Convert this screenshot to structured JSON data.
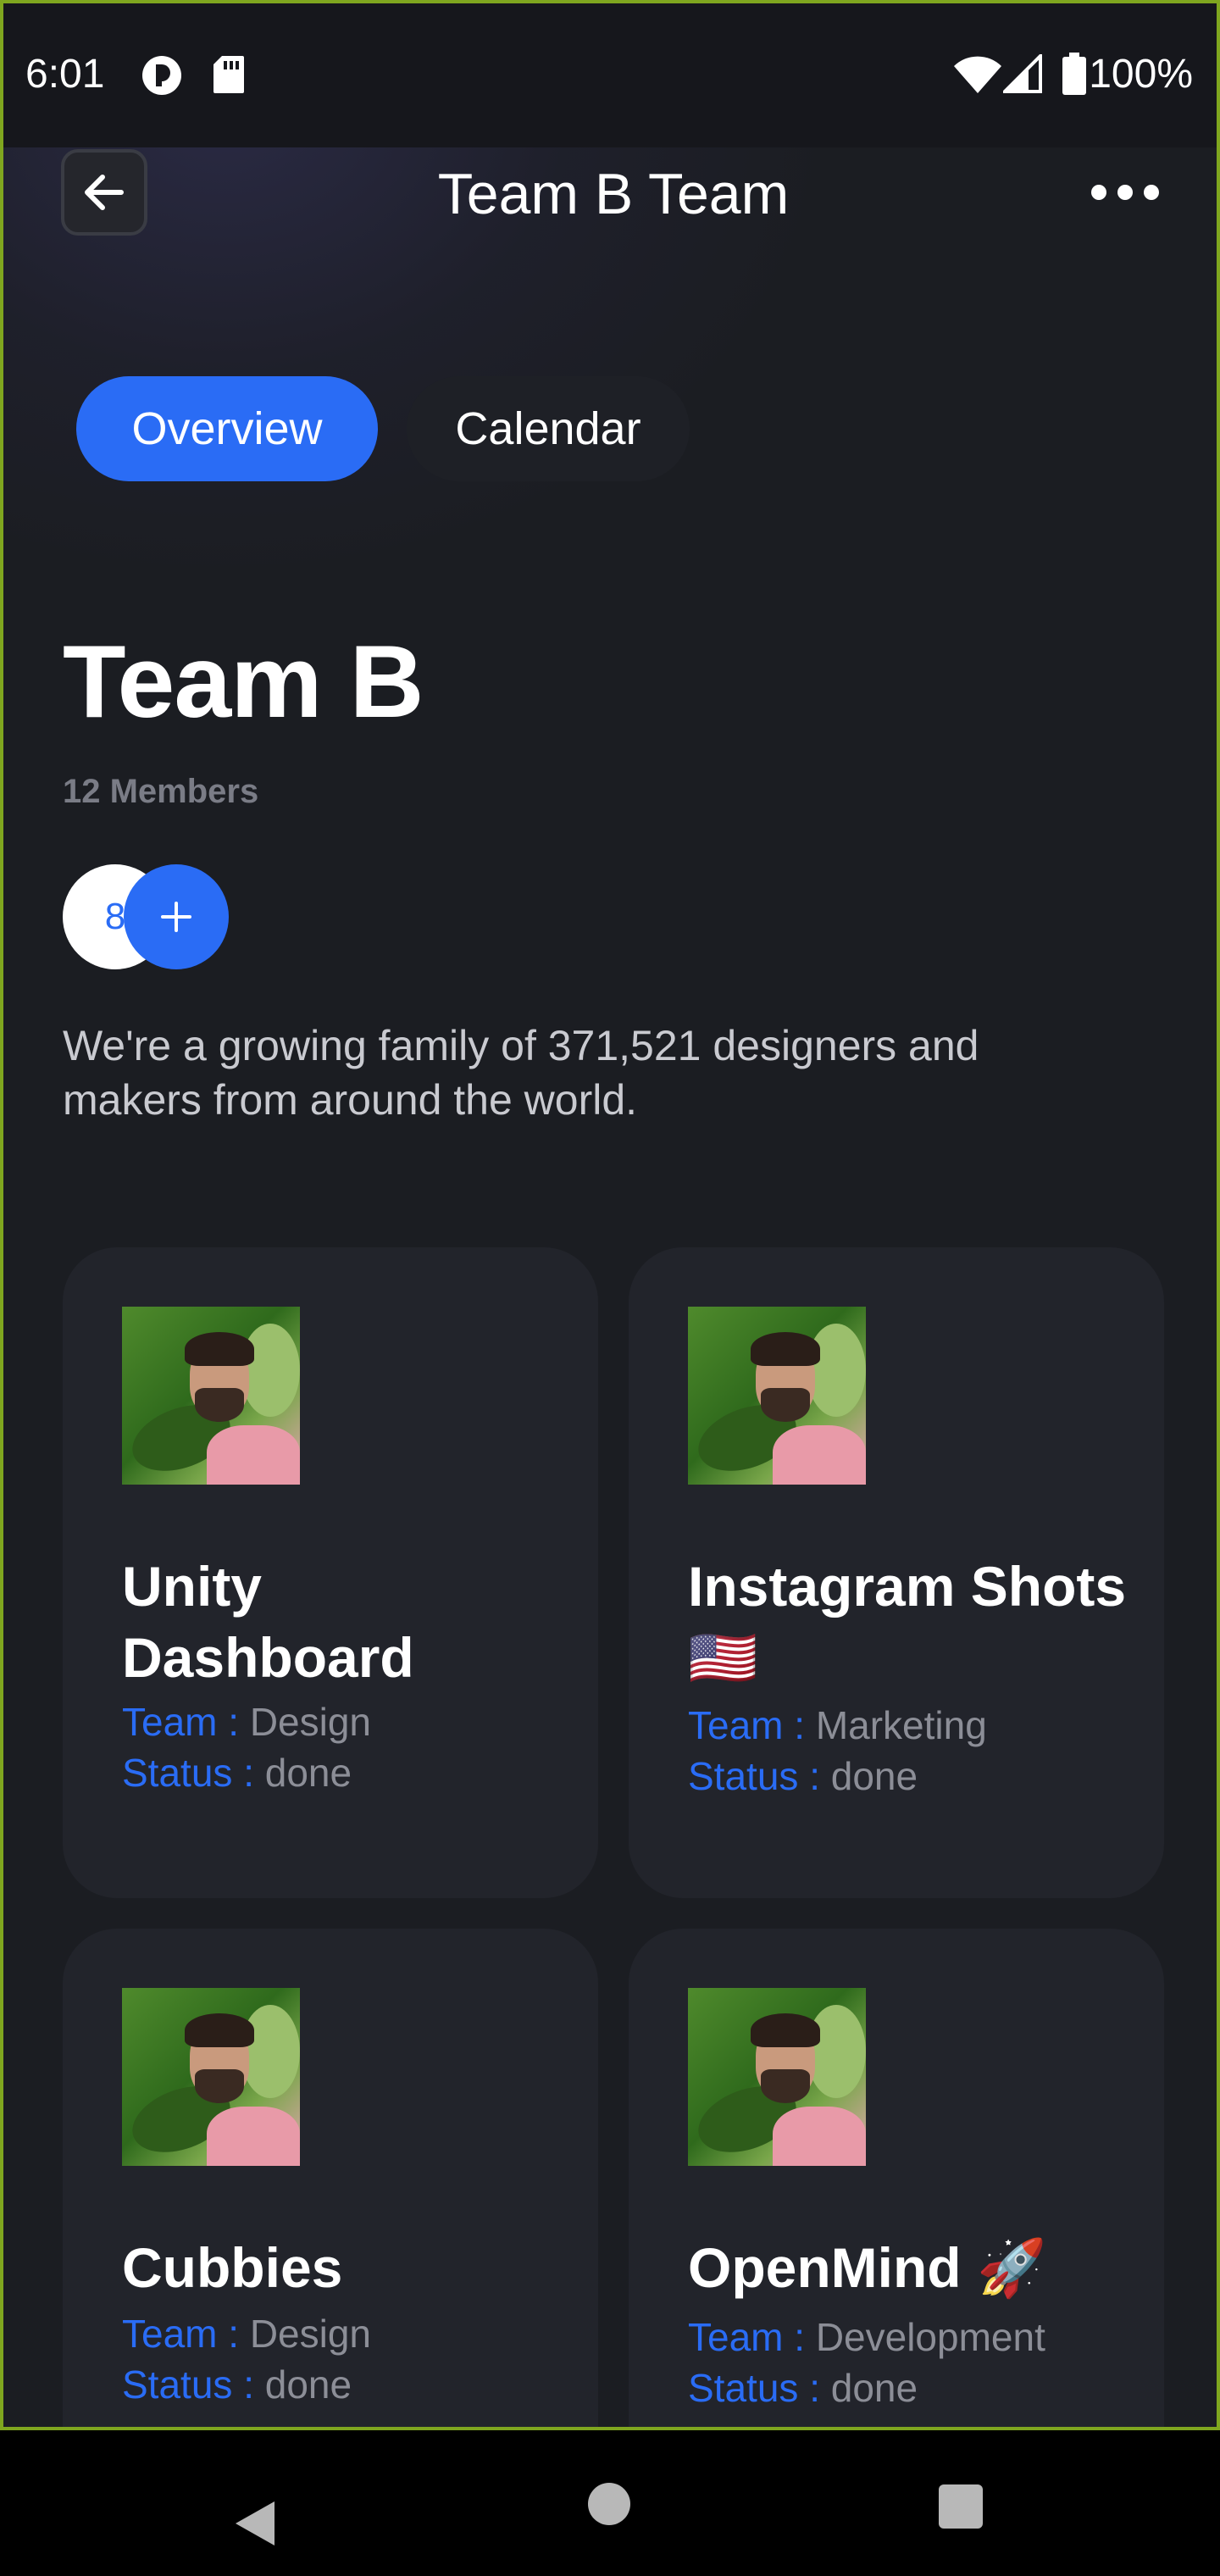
{
  "status_bar": {
    "time": "6:01",
    "battery": "100%"
  },
  "header": {
    "title": "Team B Team"
  },
  "tabs": [
    {
      "label": "Overview",
      "active": true
    },
    {
      "label": "Calendar",
      "active": false
    }
  ],
  "team": {
    "name": "Team B",
    "members_label": "12 Members",
    "avatar_count": "8",
    "description": "We're a growing family of 371,521 designers and makers from around the world."
  },
  "projects": [
    {
      "title": "Unity Dashboard",
      "team_label": "Team :",
      "team": "Design",
      "status_label": "Status :",
      "status": "done"
    },
    {
      "title": "Instagram Shots🇺🇸",
      "team_label": "Team :",
      "team": "Marketing",
      "status_label": "Status :",
      "status": "done"
    },
    {
      "title": "Cubbies",
      "team_label": "Team :",
      "team": "Design",
      "status_label": "Status :",
      "status": "done"
    },
    {
      "title": "OpenMind 🚀",
      "team_label": "Team :",
      "team": "Development",
      "status_label": "Status :",
      "status": "done"
    }
  ],
  "colors": {
    "accent": "#2a6cf5",
    "background": "#1b1d22",
    "card": "#22242b"
  }
}
